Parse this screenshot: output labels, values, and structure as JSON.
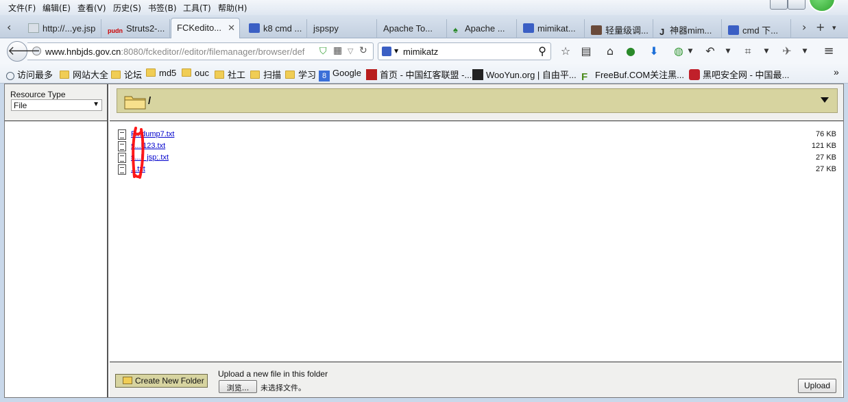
{
  "menu": [
    "文件(F)",
    "编辑(E)",
    "查看(V)",
    "历史(S)",
    "书签(B)",
    "工具(T)",
    "帮助(H)"
  ],
  "tabs": [
    {
      "label": "http://...ye.jsp"
    },
    {
      "label": "Struts2-...",
      "badge": "pudn"
    },
    {
      "label": "FCKedito...",
      "active": true
    },
    {
      "label": "k8 cmd ..."
    },
    {
      "label": "jspspy"
    },
    {
      "label": "Apache To..."
    },
    {
      "label": "Apache ..."
    },
    {
      "label": "mimikat..."
    },
    {
      "label": "轻量级调..."
    },
    {
      "label": "神器mim..."
    },
    {
      "label": "cmd 下..."
    }
  ],
  "nav": {
    "url_host": "www.hnbjds.gov.cn",
    "url_rest": ":8080/fckeditor//editor/filemanager/browser/def",
    "search_value": "mimikatz"
  },
  "bookmarks": [
    {
      "label": "访问最多",
      "icon": "search-icon"
    },
    {
      "label": "网站大全",
      "icon": "folder-icon"
    },
    {
      "label": "论坛",
      "icon": "folder-icon"
    },
    {
      "label": "md5",
      "icon": "folder-icon"
    },
    {
      "label": "ouc",
      "icon": "folder-icon"
    },
    {
      "label": "社工",
      "icon": "folder-icon"
    },
    {
      "label": "扫描",
      "icon": "folder-icon"
    },
    {
      "label": "学习",
      "icon": "folder-icon"
    },
    {
      "label": "Google",
      "icon": "google-icon"
    },
    {
      "label": "首页 - 中国红客联盟 -...",
      "icon": "huc-icon"
    },
    {
      "label": "WooYun.org | 自由平...",
      "icon": "wooyun-icon"
    },
    {
      "label": "FreeBuf.COM关注黑...",
      "icon": "freebuf-icon"
    },
    {
      "label": "黑吧安全网 - 中国最...",
      "icon": "hackbar-icon"
    }
  ],
  "resource": {
    "label": "Resource Type",
    "selected": "File"
  },
  "current_path": "/",
  "files": [
    {
      "name": "P...dump7.txt",
      "size": "76 KB"
    },
    {
      "name": "s...l123.txt",
      "size": "121 KB"
    },
    {
      "name": "s...l_jsp;.txt",
      "size": "27 KB"
    },
    {
      "name": "...txt",
      "size": "27 KB"
    }
  ],
  "footer": {
    "new_folder_label": "Create New Folder",
    "upload_caption": "Upload a new file in this folder",
    "browse_label": "浏览...",
    "no_file_label": "未选择文件。",
    "upload_label": "Upload"
  },
  "colors": {
    "folder_bar": "#d7d4a0",
    "link": "#0000cc",
    "annotation": "#ff0000"
  }
}
